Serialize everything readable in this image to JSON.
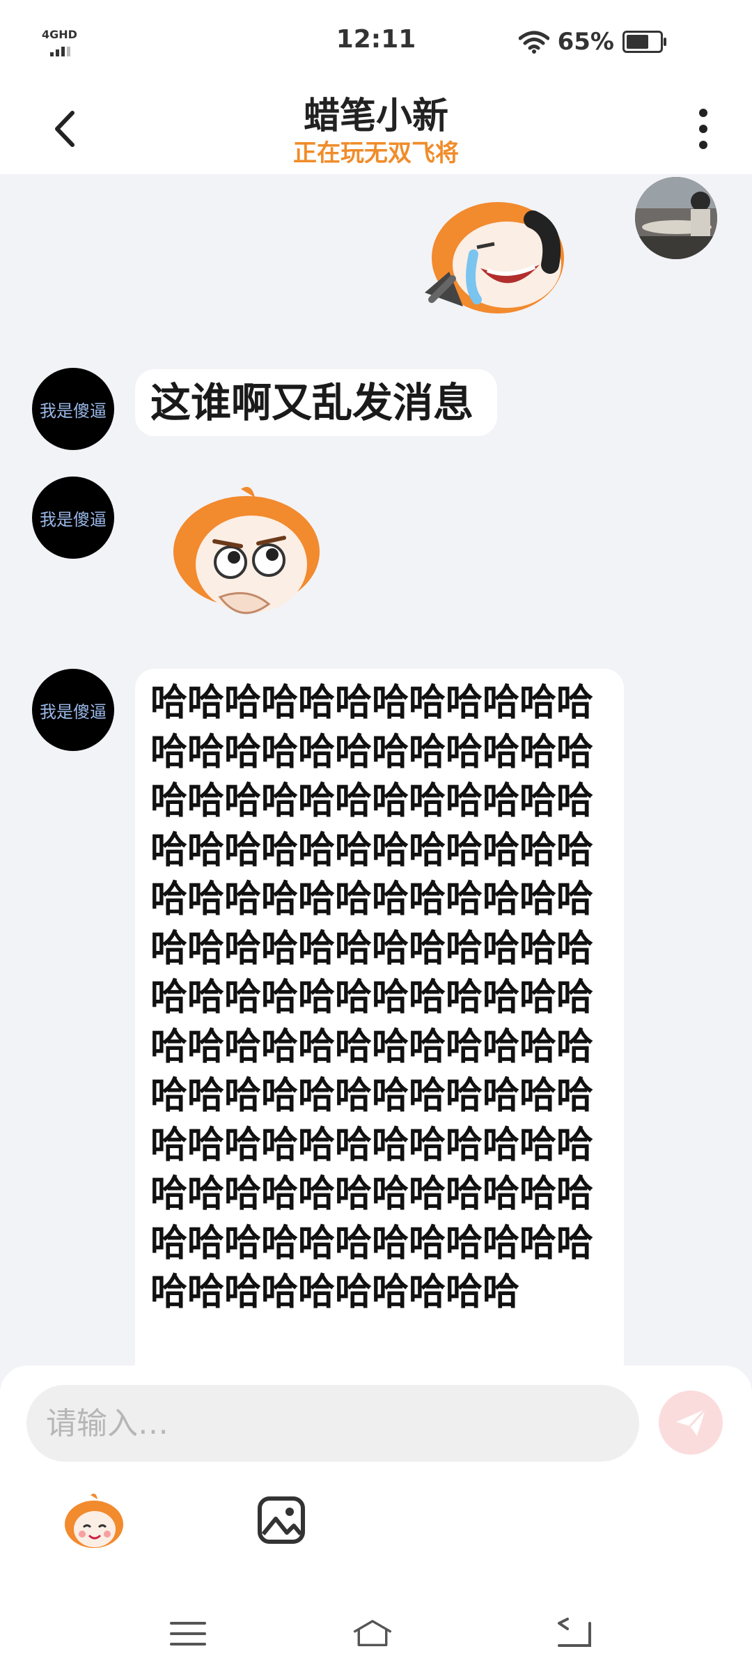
{
  "status_bar": {
    "network": "4GHD",
    "time": "12:11",
    "battery_text": "65%"
  },
  "header": {
    "title": "蜡笔小新",
    "subtitle": "正在玩无双飞将"
  },
  "messages": [
    {
      "sender": "me",
      "type": "sticker",
      "sticker": "laughing-crying-sticker"
    },
    {
      "sender": "other",
      "avatar_text": "我是傻逼",
      "type": "text",
      "text": "这谁啊又乱发消息"
    },
    {
      "sender": "other",
      "avatar_text": "我是傻逼",
      "type": "sticker",
      "sticker": "thinking-sticker"
    },
    {
      "sender": "other",
      "avatar_text": "我是傻逼",
      "type": "text",
      "text": "哈哈哈哈哈哈哈哈哈哈哈哈哈哈哈哈哈哈哈哈哈哈哈哈哈哈哈哈哈哈哈哈哈哈哈哈哈哈哈哈哈哈哈哈哈哈哈哈哈哈哈哈哈哈哈哈哈哈哈哈哈哈哈哈哈哈哈哈哈哈哈哈哈哈哈哈哈哈哈哈哈哈哈哈哈哈哈哈哈哈哈哈哈哈哈哈哈哈哈哈哈哈哈哈哈哈哈哈哈哈哈哈哈哈哈哈哈哈哈哈哈哈哈哈哈哈哈哈哈哈哈哈哈哈哈哈哈哈哈哈哈哈哈哈哈哈哈哈哈哈哈哈哈哈"
    }
  ],
  "input": {
    "placeholder": "请输入…"
  },
  "colors": {
    "accent": "#f08c2a",
    "background": "#f2f3f7",
    "send_button": "#fbdcdc"
  }
}
